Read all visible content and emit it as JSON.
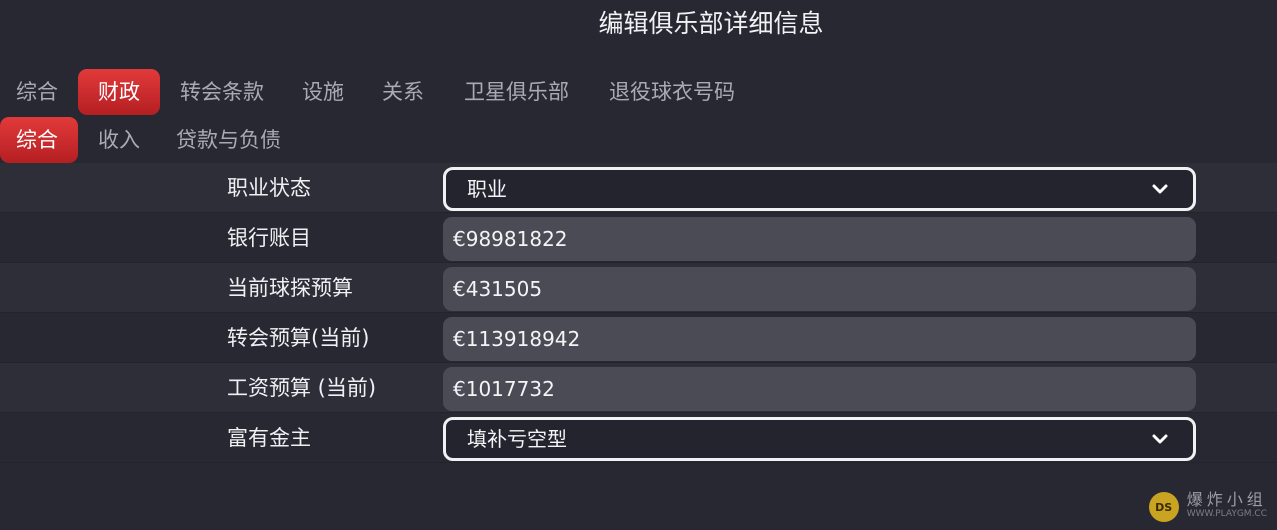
{
  "dialog": {
    "title": "编辑俱乐部详细信息"
  },
  "tabs_primary": [
    {
      "label": "综合",
      "active": false
    },
    {
      "label": "财政",
      "active": true
    },
    {
      "label": "转会条款",
      "active": false
    },
    {
      "label": "设施",
      "active": false
    },
    {
      "label": "关系",
      "active": false
    },
    {
      "label": "卫星俱乐部",
      "active": false
    },
    {
      "label": "退役球衣号码",
      "active": false
    }
  ],
  "tabs_secondary": [
    {
      "label": "综合",
      "active": true
    },
    {
      "label": "收入",
      "active": false
    },
    {
      "label": "贷款与负债",
      "active": false
    }
  ],
  "fields": {
    "professional_status": {
      "label": "职业状态",
      "value": "职业",
      "type": "dropdown"
    },
    "bank_balance": {
      "label": "银行账目",
      "value": "€98981822",
      "type": "input"
    },
    "scouting_budget": {
      "label": "当前球探预算",
      "value": "€431505",
      "type": "input"
    },
    "transfer_budget": {
      "label": "转会预算(当前)",
      "value": "€113918942",
      "type": "input"
    },
    "wage_budget": {
      "label": "工资预算 (当前)",
      "value": "€1017732",
      "type": "input"
    },
    "sugar_daddy": {
      "label": "富有金主",
      "value": "填补亏空型",
      "type": "dropdown"
    }
  },
  "icons": {
    "dropdown": "chevron-down-icon"
  },
  "watermark": {
    "text": "爆炸小组",
    "url": "WWW.PLAYGM.CC",
    "logo_text": "DS"
  },
  "colors": {
    "background": "#272832",
    "accent": "#d32f2f",
    "input_bg": "#4a4b55",
    "text": "#f0f0f3",
    "muted_text": "#a9abb4"
  }
}
